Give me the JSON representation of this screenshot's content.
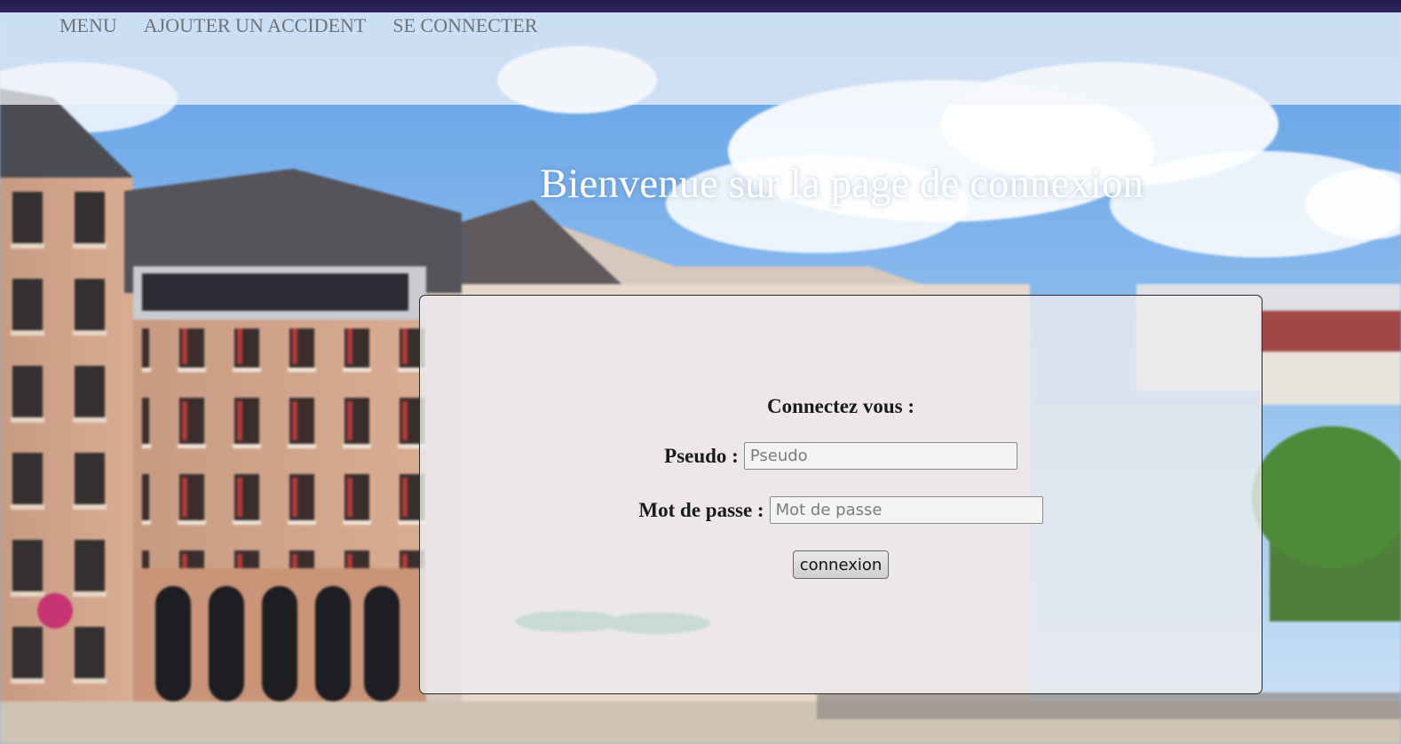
{
  "colors": {
    "top_strip": "#2f2660",
    "panel_border": "#2a2a2a",
    "nav_text": "#6f7278",
    "headline": "#ffffff"
  },
  "nav": {
    "items": [
      {
        "label": "MENU"
      },
      {
        "label": "AJOUTER UN ACCIDENT"
      },
      {
        "label": "SE CONNECTER"
      }
    ]
  },
  "main": {
    "welcome": "Bienvenue sur la page de connexion"
  },
  "login": {
    "title": "Connectez vous :",
    "pseudo_label": "Pseudo :",
    "pseudo_placeholder": "Pseudo",
    "pseudo_value": "",
    "password_label": "Mot de passe :",
    "password_placeholder": "Mot de passe",
    "password_value": "",
    "submit_label": "connexion"
  }
}
